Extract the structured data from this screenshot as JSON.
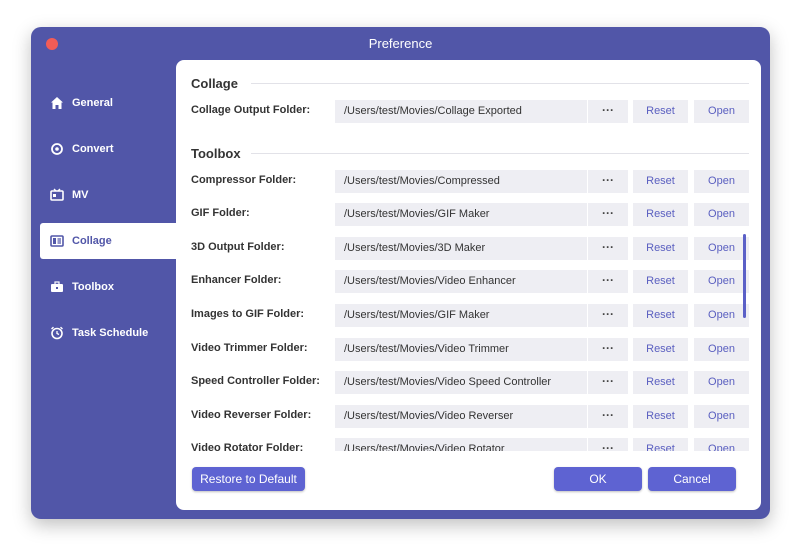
{
  "window": {
    "title": "Preference"
  },
  "sidebar": {
    "items": [
      {
        "label": "General",
        "icon": "home-icon"
      },
      {
        "label": "Convert",
        "icon": "convert-icon"
      },
      {
        "label": "MV",
        "icon": "mv-icon"
      },
      {
        "label": "Collage",
        "icon": "collage-icon",
        "active": true
      },
      {
        "label": "Toolbox",
        "icon": "toolbox-icon"
      },
      {
        "label": "Task Schedule",
        "icon": "alarm-clock-icon"
      }
    ]
  },
  "content": {
    "collage_section": "Collage",
    "toolbox_section": "Toolbox",
    "dots_label": "···",
    "reset_label": "Reset",
    "open_label": "Open",
    "collage_rows": [
      {
        "label": "Collage Output Folder:",
        "path": "/Users/test/Movies/Collage Exported"
      }
    ],
    "toolbox_rows": [
      {
        "label": "Compressor Folder:",
        "path": "/Users/test/Movies/Compressed"
      },
      {
        "label": "GIF Folder:",
        "path": "/Users/test/Movies/GIF Maker"
      },
      {
        "label": "3D Output Folder:",
        "path": "/Users/test/Movies/3D Maker"
      },
      {
        "label": "Enhancer Folder:",
        "path": "/Users/test/Movies/Video Enhancer"
      },
      {
        "label": "Images to GIF Folder:",
        "path": "/Users/test/Movies/GIF Maker"
      },
      {
        "label": "Video Trimmer Folder:",
        "path": "/Users/test/Movies/Video Trimmer"
      },
      {
        "label": "Speed Controller Folder:",
        "path": "/Users/test/Movies/Video Speed Controller"
      },
      {
        "label": "Video Reverser Folder:",
        "path": "/Users/test/Movies/Video Reverser"
      },
      {
        "label": "Video Rotator Folder:",
        "path": "/Users/test/Movies/Video Rotator"
      }
    ]
  },
  "footer": {
    "restore_label": "Restore to Default",
    "ok_label": "OK",
    "cancel_label": "Cancel"
  },
  "colors": {
    "accent": "#5156a8",
    "button": "#5e63d2",
    "close": "#f25c57"
  }
}
